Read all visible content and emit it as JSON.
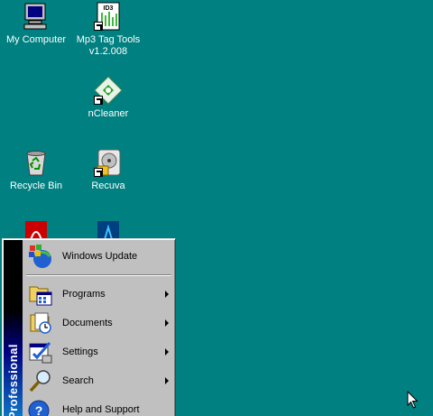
{
  "desktop": {
    "icons": [
      {
        "label": "My Computer",
        "icon": "computer-icon"
      },
      {
        "label": "Mp3 Tag Tools\nv1.2.008",
        "icon": "mp3-tag-icon",
        "badge": "ID3"
      },
      {
        "label": "nCleaner",
        "icon": "ncleaner-icon"
      },
      {
        "label": "Recycle Bin",
        "icon": "recycle-bin-icon"
      },
      {
        "label": "Recuva",
        "icon": "recuva-icon"
      },
      {
        "label": "",
        "icon": "acrobat-icon"
      },
      {
        "label": "",
        "icon": "app-icon"
      }
    ],
    "background_color": "#008080"
  },
  "start_menu": {
    "side_banner": "Professional",
    "items": [
      {
        "label": "Windows Update",
        "icon": "windows-update-icon",
        "submenu": false
      },
      {
        "label": "Programs",
        "icon": "programs-icon",
        "submenu": true
      },
      {
        "label": "Documents",
        "icon": "documents-icon",
        "submenu": true
      },
      {
        "label": "Settings",
        "icon": "settings-icon",
        "submenu": true
      },
      {
        "label": "Search",
        "icon": "search-icon",
        "submenu": true
      },
      {
        "label": "Help and Support",
        "icon": "help-icon",
        "submenu": false
      }
    ]
  }
}
